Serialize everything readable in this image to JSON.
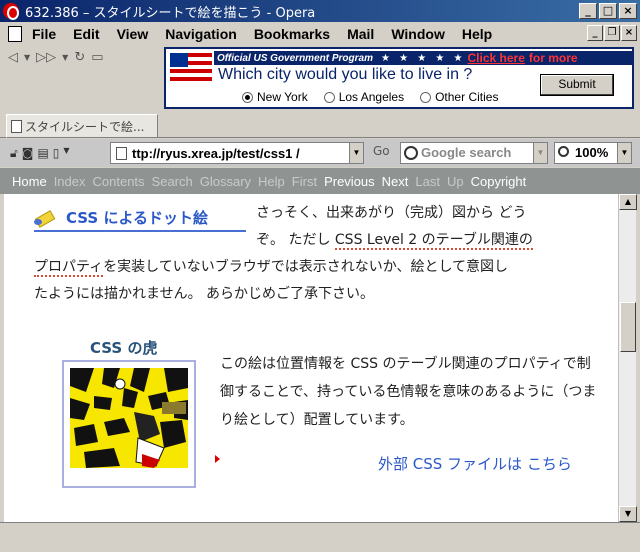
{
  "window": {
    "title": "632.386 – スタイルシートで絵を描こう - Opera",
    "buttons": [
      "_",
      "□",
      "×"
    ]
  },
  "menu": {
    "items": [
      "File",
      "Edit",
      "View",
      "Navigation",
      "Bookmarks",
      "Mail",
      "Window",
      "Help"
    ]
  },
  "ad": {
    "program": "Official US Government Program",
    "stars": "★ ★ ★ ★ ★",
    "click_here": "Click here",
    "for_more": "for more",
    "question": "Which city would you like to live in ?",
    "options": [
      {
        "label": "New York",
        "selected": true
      },
      {
        "label": "Los Angeles",
        "selected": false
      },
      {
        "label": "Other Cities",
        "selected": false
      }
    ],
    "submit": "Submit"
  },
  "tab": {
    "label": "スタイルシートで絵..."
  },
  "addressbar": {
    "url": "ttp://ryus.xrea.jp/test/css1 /",
    "go": "Go",
    "search_placeholder": "Google search",
    "zoom": "100%"
  },
  "sitenav": {
    "items": [
      {
        "label": "Home",
        "active": true
      },
      {
        "label": "Index",
        "active": false
      },
      {
        "label": "Contents",
        "active": false
      },
      {
        "label": "Search",
        "active": false
      },
      {
        "label": "Glossary",
        "active": false
      },
      {
        "label": "Help",
        "active": false
      },
      {
        "label": "First",
        "active": false
      },
      {
        "label": "Previous",
        "active": true
      },
      {
        "label": "Next",
        "active": true
      },
      {
        "label": "Last",
        "active": false
      },
      {
        "label": "Up",
        "active": false
      },
      {
        "label": "Copyright",
        "active": true
      }
    ]
  },
  "page": {
    "heading": "CSS によるドット絵",
    "intro_1": "さっそく、出来あがり（完成）図から どう",
    "intro_2a": "ぞ。 ただし ",
    "intro_2_link": "CSS Level 2 のテーブル関連の",
    "intro_3_link": "プロパティ",
    "intro_3b": "を実装していないブラウザでは表示されないか、絵として意図し",
    "intro_4": "たようには描かれません。 あらかじめご了承下さい。",
    "tiger_title": "CSS の虎",
    "desc": "この絵は位置情報を CSS のテーブル関連のプロパティで制御することで、持っている色情報を意味のあるように（つまり絵として）配置しています。",
    "external_link": "外部 CSS ファイルは こちら"
  }
}
